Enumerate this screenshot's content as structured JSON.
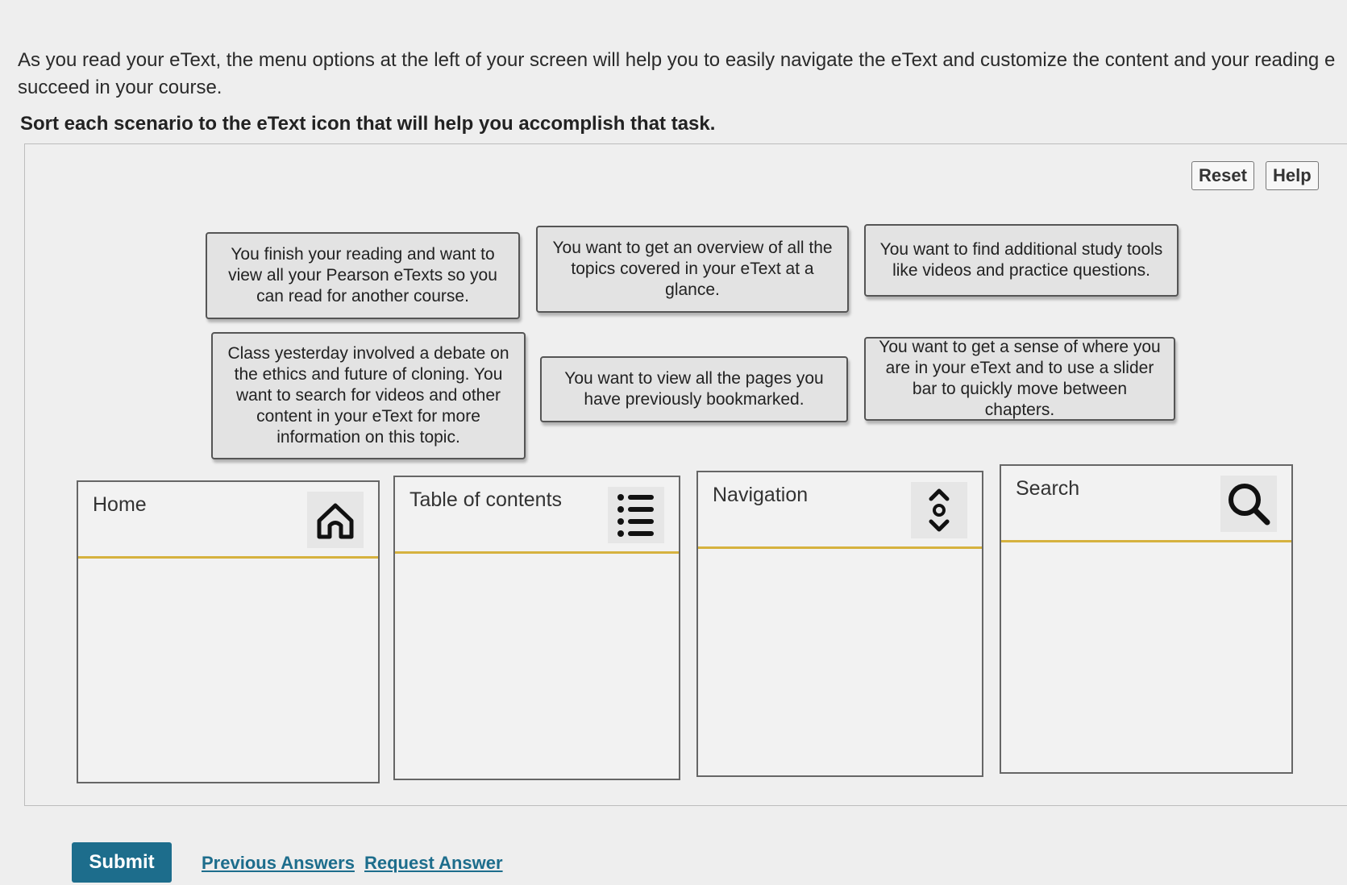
{
  "intro": {
    "line1": "As you read your eText, the menu options at the left of your screen will help you to easily navigate the eText and customize the content and your reading e",
    "line2": "succeed in your course."
  },
  "instruction": "Sort each scenario to the eText icon that will help you accomplish that task.",
  "toolbar": {
    "reset_label": "Reset",
    "help_label": "Help"
  },
  "cards": [
    {
      "text": "You finish your reading and want to view all your Pearson eTexts so you can read for another course."
    },
    {
      "text": "You want to get an overview of all the topics covered in your eText at a glance."
    },
    {
      "text": "You want to find additional study tools like videos and practice questions."
    },
    {
      "text": "Class yesterday involved a debate on the ethics and future of cloning. You want to search for videos and other content in your eText for more information on this topic."
    },
    {
      "text": "You want to view all the pages you have previously bookmarked."
    },
    {
      "text": "You want to get a sense of where you are in your eText and to use a slider bar to quickly move between chapters."
    }
  ],
  "zones": [
    {
      "title": "Home",
      "icon": "home-icon"
    },
    {
      "title": "Table of contents",
      "icon": "list-icon"
    },
    {
      "title": "Navigation",
      "icon": "navigation-icon"
    },
    {
      "title": "Search",
      "icon": "search-icon"
    }
  ],
  "actions": {
    "submit_label": "Submit",
    "previous_answers_label": "Previous Answers",
    "request_answer_label": "Request Answer"
  },
  "colors": {
    "accent": "#1d6d8c",
    "zone_divider": "#d6b23f"
  }
}
